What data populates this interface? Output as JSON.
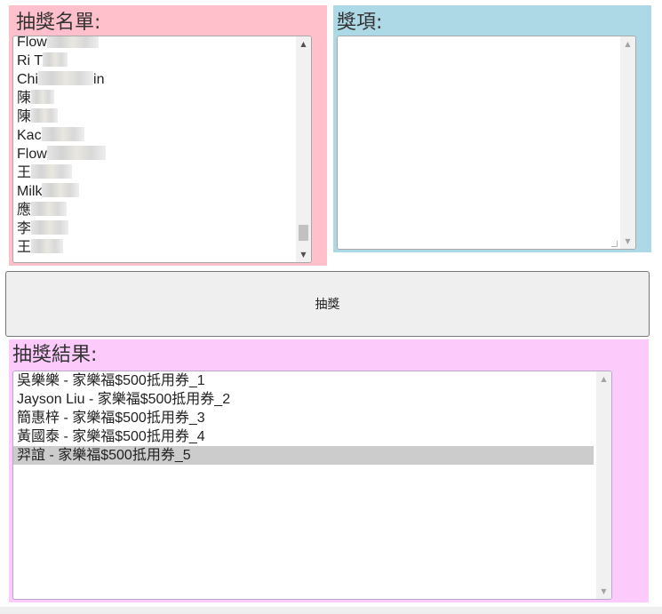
{
  "entrants_panel": {
    "title": "抽獎名單:",
    "items": [
      "Flow",
      "Ri T",
      "Chi",
      "陳",
      "陳",
      "Kac",
      "Flow",
      "王",
      "Milk",
      "應",
      "李",
      "王"
    ],
    "item_suffixes": [
      "",
      "",
      "in",
      "",
      "",
      "",
      "",
      "",
      "",
      "",
      "",
      ""
    ]
  },
  "prizes_panel": {
    "title": "獎項:",
    "items": []
  },
  "draw_button": {
    "label": "抽獎"
  },
  "results_panel": {
    "title": "抽獎結果:",
    "items": [
      "吳樂樂 - 家樂福$500抵用券_1",
      "Jayson Liu - 家樂福$500抵用券_2",
      "簡惠梓 - 家樂福$500抵用券_3",
      "黃國泰 - 家樂福$500抵用券_4",
      "羿誼 - 家樂福$500抵用券_5"
    ],
    "selected_index": 4
  },
  "colors": {
    "entrants_bg": "#ffc0cb",
    "prizes_bg": "#add8e6",
    "results_bg": "#fccbfc",
    "button_bg": "#efefef",
    "selected_row": "#cccccc"
  },
  "icons": {
    "scroll_up": "▲",
    "scroll_down": "▼"
  }
}
